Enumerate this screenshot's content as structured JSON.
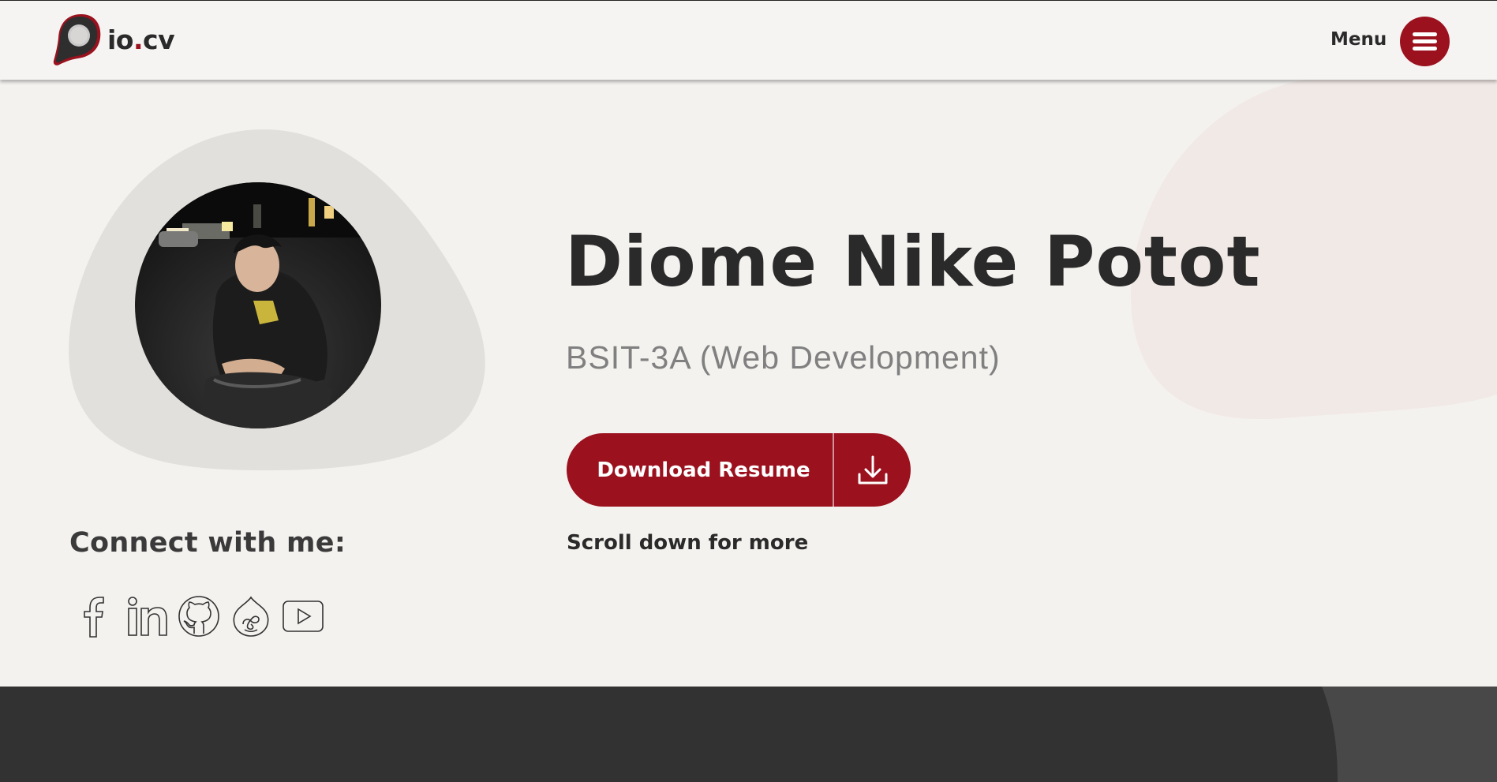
{
  "header": {
    "logo_text_prefix": "io",
    "logo_text_dot": ".",
    "logo_text_suffix": "cv",
    "menu_label": "Menu"
  },
  "hero": {
    "name": "Diome Nike Potot",
    "subtitle": "BSIT-3A (Web Development)",
    "download_label": "Download Resume",
    "scroll_hint": "Scroll down for more"
  },
  "connect": {
    "title": "Connect with me:",
    "socials": [
      "facebook-icon",
      "linkedin-icon",
      "github-icon",
      "drupal-icon",
      "youtube-icon"
    ]
  },
  "colors": {
    "accent": "#9b111e",
    "text_dark": "#2b2a2a",
    "text_muted": "#808080",
    "background": "#f4f2ef",
    "dark_band": "#323232"
  }
}
